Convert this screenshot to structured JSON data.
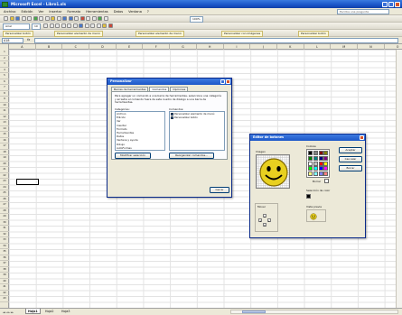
{
  "window": {
    "title": "Microsoft Excel - Libro1.xls"
  },
  "menu": {
    "items": [
      "Archivo",
      "Edición",
      "Ver",
      "Insertar",
      "Formato",
      "Herramientas",
      "Datos",
      "Ventana",
      "?"
    ],
    "help_placeholder": "Escriba una pregunta"
  },
  "toolbar": {
    "zoom": "100%",
    "font": "Arial",
    "font_size": "10",
    "custom_buttons": [
      "Personalizar botón",
      "Personalizar elemento de menú",
      "Personalizar elemento de menú",
      "Personalizar con imágenes",
      "Personalizar botón"
    ]
  },
  "formula_bar": {
    "name_box": "A18",
    "fx": "fx",
    "value": ""
  },
  "grid": {
    "columns": [
      "A",
      "B",
      "C",
      "D",
      "E",
      "F",
      "G",
      "H",
      "I",
      "J",
      "K",
      "L",
      "M",
      "N",
      "O"
    ],
    "rows": [
      "1",
      "2",
      "3",
      "4",
      "5",
      "6",
      "7",
      "8",
      "9",
      "10",
      "11",
      "12",
      "13",
      "14",
      "15",
      "16",
      "17",
      "18",
      "19",
      "20",
      "21",
      "22",
      "23",
      "24",
      "25",
      "26",
      "27",
      "28",
      "29",
      "30",
      "31",
      "32",
      "33",
      "34",
      "35",
      "36",
      "37",
      "38",
      "39",
      "40",
      "41",
      "42",
      "43"
    ]
  },
  "sheets": {
    "tabs": [
      "Hoja1",
      "Hoja2",
      "Hoja3"
    ],
    "active": "Hoja1"
  },
  "customize_dialog": {
    "title": "Personalizar",
    "tabs": [
      "Barras de herramientas",
      "Comandos",
      "Opciones"
    ],
    "description": "Para agregar un comando a una barra de herramientas, seleccione una categoría y arrastre el comando fuera de este cuadro de diálogo a una barra de herramientas.",
    "categories_label": "Categorías:",
    "commands_label": "Comandos:",
    "categories": [
      "Archivo",
      "Edición",
      "Ver",
      "Insertar",
      "Formato",
      "Herramientas",
      "Datos",
      "Ventana y ayuda",
      "Dibujo",
      "AutoFormas",
      "Gráfico",
      "Web",
      "Formularios",
      "Cuadro de controles",
      "Macros",
      "Menús integrados",
      "Nuevo menú"
    ],
    "selected_category": "Macros",
    "commands": [
      "Personalizar elemento de menú",
      "Personalizar botón"
    ],
    "modify_selection": "Modificar selección",
    "reorganize": "Reorganizar comandos...",
    "close": "Cerrar"
  },
  "button_editor": {
    "title": "Editor de botones",
    "image_label": "Imagen",
    "colors_label": "Colores",
    "erase_label": "Borrar",
    "transparent_label": "Selección de color",
    "move_label": "Mover",
    "preview_label": "Vista previa",
    "accept": "Aceptar",
    "cancel": "Cancelar",
    "clear": "Borrar",
    "palette": [
      "#000000",
      "#808080",
      "#800000",
      "#808000",
      "#008000",
      "#008080",
      "#000080",
      "#800080",
      "#ffffff",
      "#c0c0c0",
      "#ff0000",
      "#ffff00",
      "#00ff00",
      "#00ffff",
      "#0000ff",
      "#ff00ff",
      "#ffff80",
      "#80ffff",
      "#8080ff",
      "#ff8080"
    ]
  }
}
